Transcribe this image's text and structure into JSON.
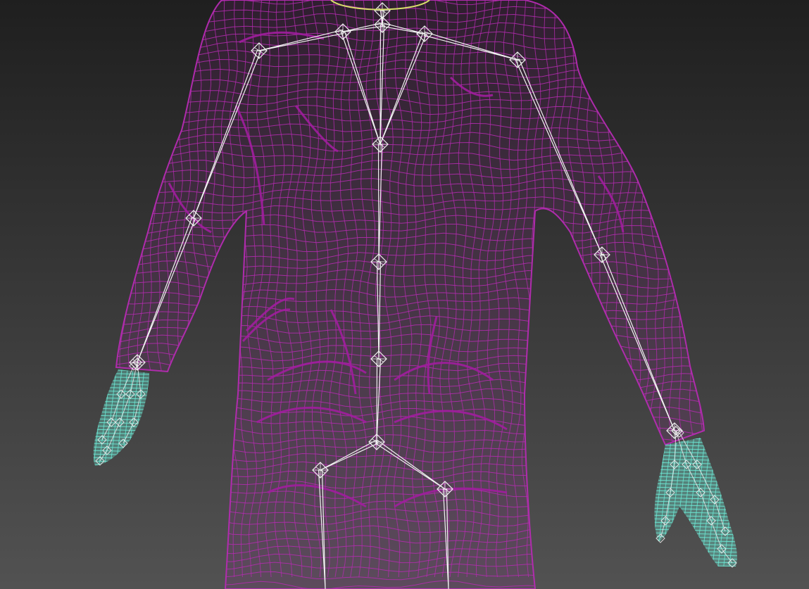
{
  "viewport": {
    "background_top": "#1f1f1f",
    "background_bottom": "#525252"
  },
  "scene": {
    "mesh_color": "#b52bb2",
    "mesh_dense_color": "#a11d9f",
    "hand_mesh_color": "#6de8d4",
    "bone_color": "#f2f2f2",
    "neck_accent_color": "#d8e06a",
    "objects": [
      "character-body-wireframe",
      "biped-skeleton",
      "left-hand-wireframe",
      "right-hand-wireframe"
    ]
  }
}
